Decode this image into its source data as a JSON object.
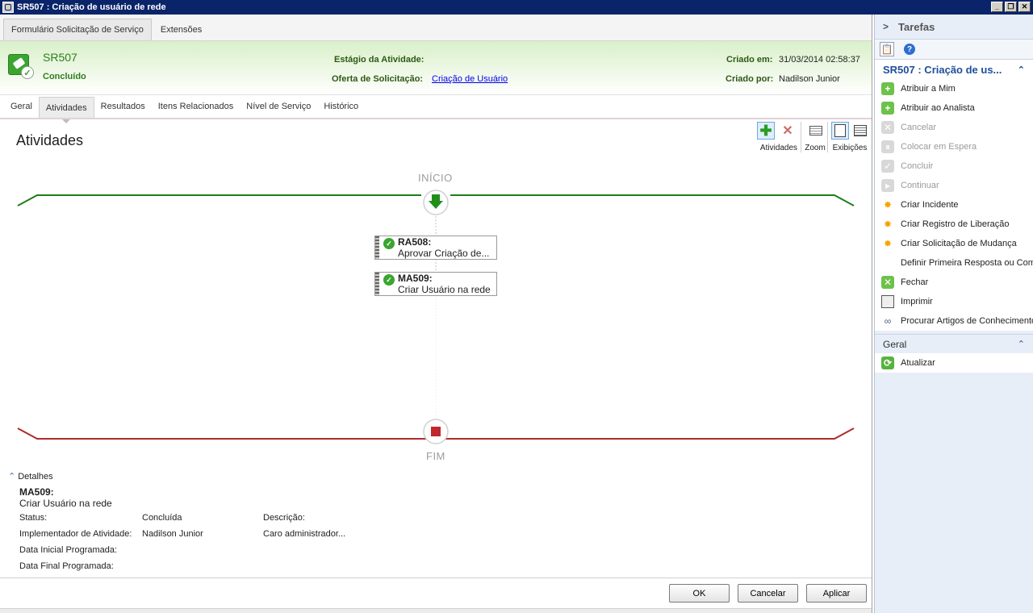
{
  "window": {
    "title": "SR507 : Criação de usuário de rede",
    "buttons": [
      "_",
      "❐",
      "✕"
    ]
  },
  "form_tabs": [
    {
      "label": "Formulário Solicitação de Serviço",
      "active": true
    },
    {
      "label": "Extensões",
      "active": false
    }
  ],
  "header": {
    "id": "SR507",
    "status": "Concluído",
    "stage_label": "Estágio da Atividade:",
    "stage_value": "",
    "offering_label": "Oferta de Solicitação:",
    "offering_value": "Criação de Usuário",
    "created_on_label": "Criado em:",
    "created_on_value": "31/03/2014 02:58:37",
    "created_by_label": "Criado por:",
    "created_by_value": "Nadilson Junior"
  },
  "page_tabs": [
    {
      "label": "Geral",
      "active": false
    },
    {
      "label": "Atividades",
      "active": true
    },
    {
      "label": "Resultados",
      "active": false
    },
    {
      "label": "Itens Relacionados",
      "active": false
    },
    {
      "label": "Nível de Serviço",
      "active": false
    },
    {
      "label": "Histórico",
      "active": false
    }
  ],
  "section_title": "Atividades",
  "toolbar": {
    "activities_label": "Atividades",
    "zoom_label": "Zoom",
    "views_label": "Exibições"
  },
  "workflow": {
    "start_label": "INÍCIO",
    "end_label": "FIM",
    "activities": [
      {
        "id": "RA508:",
        "title": "Aprovar Criação de..."
      },
      {
        "id": "MA509:",
        "title": "Criar Usuário na rede"
      }
    ],
    "colors": {
      "start_line": "#1f7d1a",
      "end_line": "#b02a2a"
    }
  },
  "details": {
    "toggle_label": "Detalhes",
    "id": "MA509:",
    "name": "Criar Usuário na rede",
    "status_label": "Status:",
    "status_value": "Concluída",
    "implementer_label": "Implementador de Atividade:",
    "implementer_value": "Nadilson Junior",
    "start_label": "Data Inicial Programada:",
    "end_label": "Data Final Programada:",
    "description_label": "Descrição:",
    "description_value": "Caro administrador..."
  },
  "buttons": {
    "ok": "OK",
    "cancel": "Cancelar",
    "apply": "Aplicar"
  },
  "tasks": {
    "header": "Tarefas",
    "section_title": "SR507 : Criação de us...",
    "items": [
      {
        "label": "Atribuir a Mim",
        "icon": "assign-user-icon",
        "enabled": true
      },
      {
        "label": "Atribuir ao Analista",
        "icon": "assign-analyst-icon",
        "enabled": true
      },
      {
        "label": "Cancelar",
        "icon": "cancel-icon",
        "enabled": false
      },
      {
        "label": "Colocar em Espera",
        "icon": "hold-icon",
        "enabled": false
      },
      {
        "label": "Concluir",
        "icon": "complete-icon",
        "enabled": false
      },
      {
        "label": "Continuar",
        "icon": "continue-icon",
        "enabled": false
      },
      {
        "label": "Criar Incidente",
        "icon": "star-icon",
        "enabled": true
      },
      {
        "label": "Criar Registro de Liberação",
        "icon": "star-icon",
        "enabled": true
      },
      {
        "label": "Criar Solicitação de Mudança",
        "icon": "star-icon",
        "enabled": true
      },
      {
        "label": "Definir Primeira Resposta ou Com",
        "icon": "",
        "enabled": true
      },
      {
        "label": "Fechar",
        "icon": "close-request-icon",
        "enabled": true
      },
      {
        "label": "Imprimir",
        "icon": "printer-icon",
        "enabled": true
      },
      {
        "label": "Procurar Artigos de Conhecimento",
        "icon": "search-knowledge-icon",
        "enabled": true
      }
    ],
    "general_title": "Geral",
    "general_items": [
      {
        "label": "Atualizar",
        "icon": "refresh-icon"
      }
    ]
  }
}
